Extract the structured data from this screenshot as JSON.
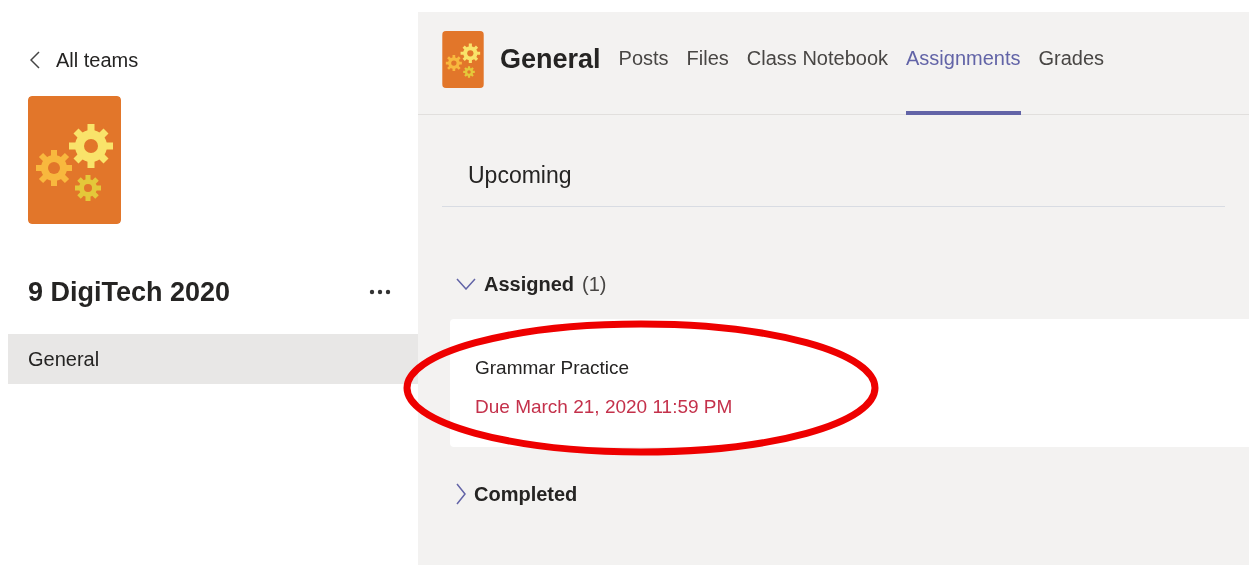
{
  "sidebar": {
    "back_link": "All teams",
    "team_name": "9 DigiTech 2020",
    "channels": [
      {
        "label": "General",
        "selected": true
      }
    ]
  },
  "header": {
    "channel": "General",
    "tabs": [
      {
        "label": "Posts",
        "selected": false
      },
      {
        "label": "Files",
        "selected": false
      },
      {
        "label": "Class Notebook",
        "selected": false
      },
      {
        "label": "Assignments",
        "selected": true
      },
      {
        "label": "Grades",
        "selected": false
      }
    ]
  },
  "view": {
    "title": "Upcoming"
  },
  "groups": [
    {
      "label": "Assigned",
      "count": "(1)",
      "expanded": true,
      "assignments": [
        {
          "title": "Grammar Practice",
          "due": "Due March 21, 2020 11:59 PM"
        }
      ]
    },
    {
      "label": "Completed",
      "expanded": false
    }
  ],
  "annotations": [
    {
      "kind": "ellipse"
    }
  ]
}
